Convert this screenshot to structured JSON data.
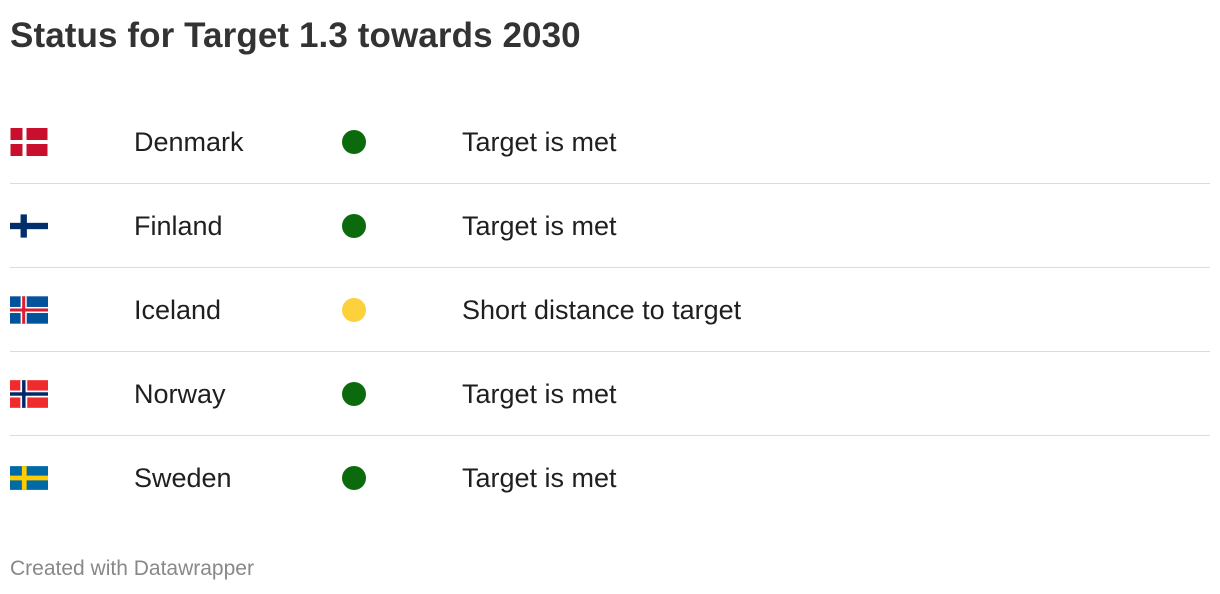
{
  "title": "Status for Target 1.3 towards 2030",
  "rows": [
    {
      "flag_icon": "denmark-flag-icon",
      "country": "Denmark",
      "status_color": "#0b6a0b",
      "status": "Target is met"
    },
    {
      "flag_icon": "finland-flag-icon",
      "country": "Finland",
      "status_color": "#0b6a0b",
      "status": "Target is met"
    },
    {
      "flag_icon": "iceland-flag-icon",
      "country": "Iceland",
      "status_color": "#fdd13c",
      "status": "Short distance to target"
    },
    {
      "flag_icon": "norway-flag-icon",
      "country": "Norway",
      "status_color": "#0b6a0b",
      "status": "Target is met"
    },
    {
      "flag_icon": "sweden-flag-icon",
      "country": "Sweden",
      "status_color": "#0b6a0b",
      "status": "Target is met"
    }
  ],
  "footer": "Created with Datawrapper"
}
